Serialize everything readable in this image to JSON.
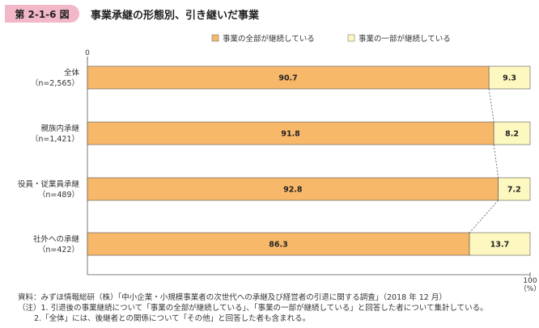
{
  "figure": {
    "badge": "第 2-1-6 図",
    "title": "事業承継の形態別、引き継いだ事業"
  },
  "legend": [
    {
      "name": "事業の全部が継続している",
      "color": "#f7b86a"
    },
    {
      "name": "事業の一部が継続している",
      "color": "#fdf8c0"
    }
  ],
  "chart_data": {
    "type": "bar",
    "orientation": "horizontal",
    "stacked": true,
    "percent_stacked": true,
    "categories": [
      {
        "label": "全体",
        "sub": "（n=2,565）"
      },
      {
        "label": "親族内承継",
        "sub": "（n=1,421）"
      },
      {
        "label": "役員・従業員承継",
        "sub": "（n=489）"
      },
      {
        "label": "社外への承継",
        "sub": "（n=422）"
      }
    ],
    "series": [
      {
        "name": "事業の全部が継続している",
        "values": [
          90.7,
          91.8,
          92.8,
          86.3
        ],
        "color": "#f7b86a"
      },
      {
        "name": "事業の一部が継続している",
        "values": [
          9.3,
          8.2,
          7.2,
          13.7
        ],
        "color": "#fdf8c0"
      }
    ],
    "xlim": [
      0,
      100
    ],
    "xticks": [
      "0",
      "100"
    ],
    "x_unit": "（%）",
    "legend_position": "top-right",
    "grid": false,
    "connector_lines": true
  },
  "notes": {
    "source": "資料：みずほ情報総研（株）「中小企業・小規模事業者の次世代への承継及び経営者の引退に関する調査」（2018 年 12 月）",
    "note1": "（注）1. 引退後の事業継続について「事業の全部が継続している」、「事業の一部が継続している」と回答した者について集計している。",
    "note2": "2.「全体」には、後継者との関係について「その他」と回答した者も含まれる。"
  }
}
